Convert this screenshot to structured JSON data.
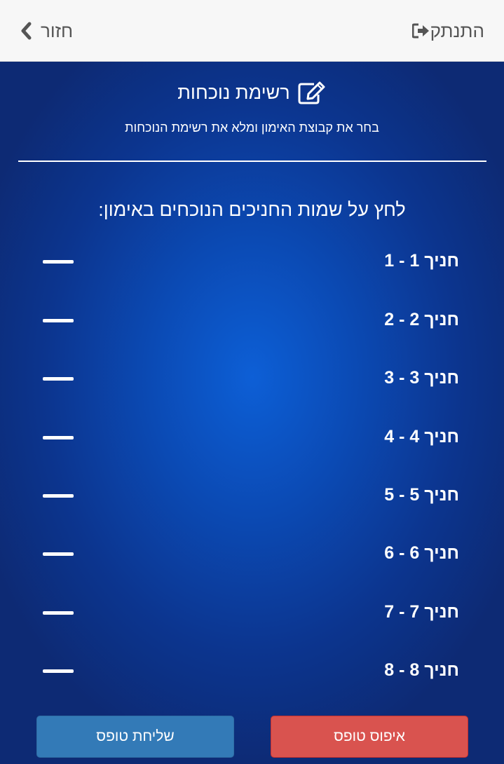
{
  "header": {
    "logout_label": "התנתק",
    "back_label": "חזור"
  },
  "page": {
    "title": "רשימת נוכחות",
    "subtitle": "בחר את קבוצת האימון ומלא את רשימת הנוכחות",
    "instruction": "לחץ על שמות החניכים הנוכחים באימון:"
  },
  "trainees": [
    {
      "name": "חניך 1 - 1"
    },
    {
      "name": "חניך 2 - 2"
    },
    {
      "name": "חניך 3 - 3"
    },
    {
      "name": "חניך 4 - 4"
    },
    {
      "name": "חניך 5 - 5"
    },
    {
      "name": "חניך 6 - 6"
    },
    {
      "name": "חניך 7 - 7"
    },
    {
      "name": "חניך 8 - 8"
    }
  ],
  "buttons": {
    "reset_label": "איפוס טופס",
    "send_label": "שליחת טופס"
  },
  "colors": {
    "reset_button": "#d9534f",
    "send_button": "#337ab7",
    "background": "#0c4ab4"
  },
  "icons": {
    "logout": "sign-out-icon",
    "back": "chevron-left-icon",
    "title": "edit-icon"
  }
}
